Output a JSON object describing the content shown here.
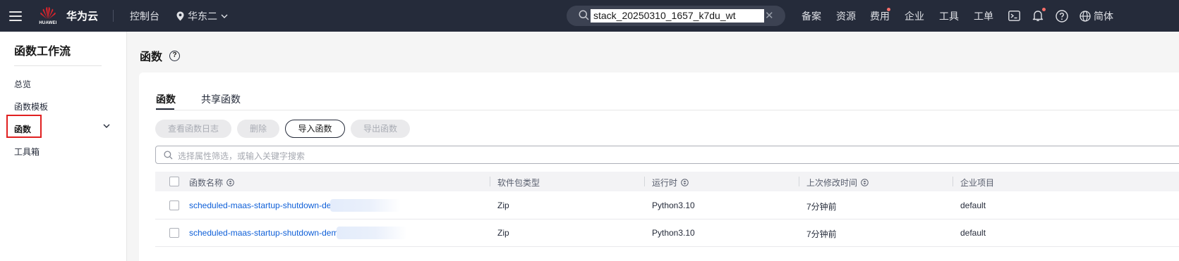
{
  "topbar": {
    "logo_text": "HUAWEI",
    "brand": "华为云",
    "console": "控制台",
    "region": "华东二",
    "search_value": "stack_20250310_1657_k7du_wt",
    "nav": [
      "备案",
      "资源",
      "费用",
      "企业",
      "工具",
      "工单"
    ],
    "language": "简体"
  },
  "sidebar": {
    "title": "函数工作流",
    "items": [
      {
        "label": "总览"
      },
      {
        "label": "函数模板"
      },
      {
        "label": "函数"
      },
      {
        "label": "工具箱"
      }
    ]
  },
  "main": {
    "title": "函数",
    "tabs": [
      "函数",
      "共享函数"
    ],
    "buttons": {
      "view_logs": "查看函数日志",
      "delete": "删除",
      "import": "导入函数",
      "export": "导出函数"
    },
    "filter_placeholder": "选择属性筛选，或输入关键字搜索",
    "table": {
      "columns": [
        "函数名称",
        "软件包类型",
        "运行时",
        "上次修改时间",
        "企业项目"
      ],
      "rows": [
        {
          "name": "scheduled-maas-startup-shutdown-dem",
          "package": "Zip",
          "runtime": "Python3.10",
          "modified": "7分钟前",
          "project": "default"
        },
        {
          "name": "scheduled-maas-startup-shutdown-demo-",
          "package": "Zip",
          "runtime": "Python3.10",
          "modified": "7分钟前",
          "project": "default"
        }
      ]
    }
  },
  "colors": {
    "topbar_bg": "#252b3a",
    "link": "#0e5fd8",
    "highlight_box": "#e02020",
    "notification_dot": "#f66f6a"
  }
}
